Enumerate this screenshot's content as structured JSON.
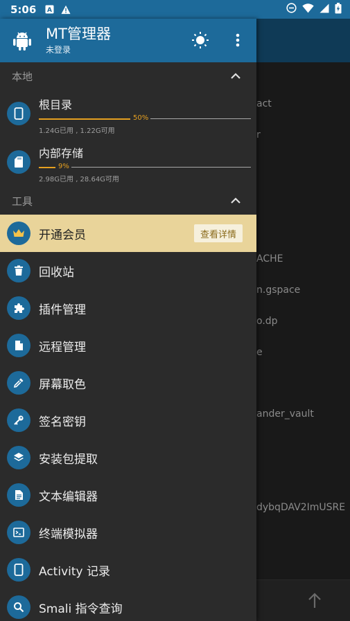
{
  "status_bar": {
    "time": "5:06",
    "left_icons": [
      "a-box-icon",
      "warning-icon"
    ],
    "right_icons": [
      "dnd-icon",
      "wifi-icon",
      "signal-icon",
      "battery-icon"
    ]
  },
  "drawer": {
    "app_title": "MT管理器",
    "app_subtitle": "未登录",
    "sections": {
      "local": {
        "title": "本地"
      },
      "tools": {
        "title": "工具"
      }
    },
    "storages": [
      {
        "name": "根目录",
        "percent_label": "50%",
        "used_fraction": 0.5,
        "info": "1.24G已用 , 1.22G可用",
        "icon": "phone-icon"
      },
      {
        "name": "内部存储",
        "percent_label": "9%",
        "used_fraction": 0.09,
        "info": "2.98G已用 , 28.64G可用",
        "icon": "sd-card-icon"
      }
    ],
    "vip": {
      "label": "开通会员",
      "button": "查看详情",
      "icon": "crown-icon"
    },
    "items": [
      {
        "label": "回收站",
        "icon": "trash-icon"
      },
      {
        "label": "插件管理",
        "icon": "puzzle-icon"
      },
      {
        "label": "远程管理",
        "icon": "file-icon"
      },
      {
        "label": "屏幕取色",
        "icon": "eyedropper-icon"
      },
      {
        "label": "签名密钥",
        "icon": "key-icon"
      },
      {
        "label": "安装包提取",
        "icon": "layers-icon"
      },
      {
        "label": "文本编辑器",
        "icon": "document-icon"
      },
      {
        "label": "终端模拟器",
        "icon": "terminal-icon"
      },
      {
        "label": "Activity 记录",
        "icon": "phone-icon"
      },
      {
        "label": "Smali 指令查询",
        "icon": "search-icon"
      }
    ]
  },
  "background": {
    "visible_fragments": [
      "act",
      "r",
      "ACHE",
      "n.gspace",
      "o.dp",
      "e",
      "ander_vault",
      "dybqDAV2ImUSRE"
    ]
  },
  "colors": {
    "header_blue": "#1d6a9a",
    "drawer_bg": "#2b2b2b",
    "accent_orange": "#e6a020",
    "vip_bg": "#e9d49a"
  }
}
